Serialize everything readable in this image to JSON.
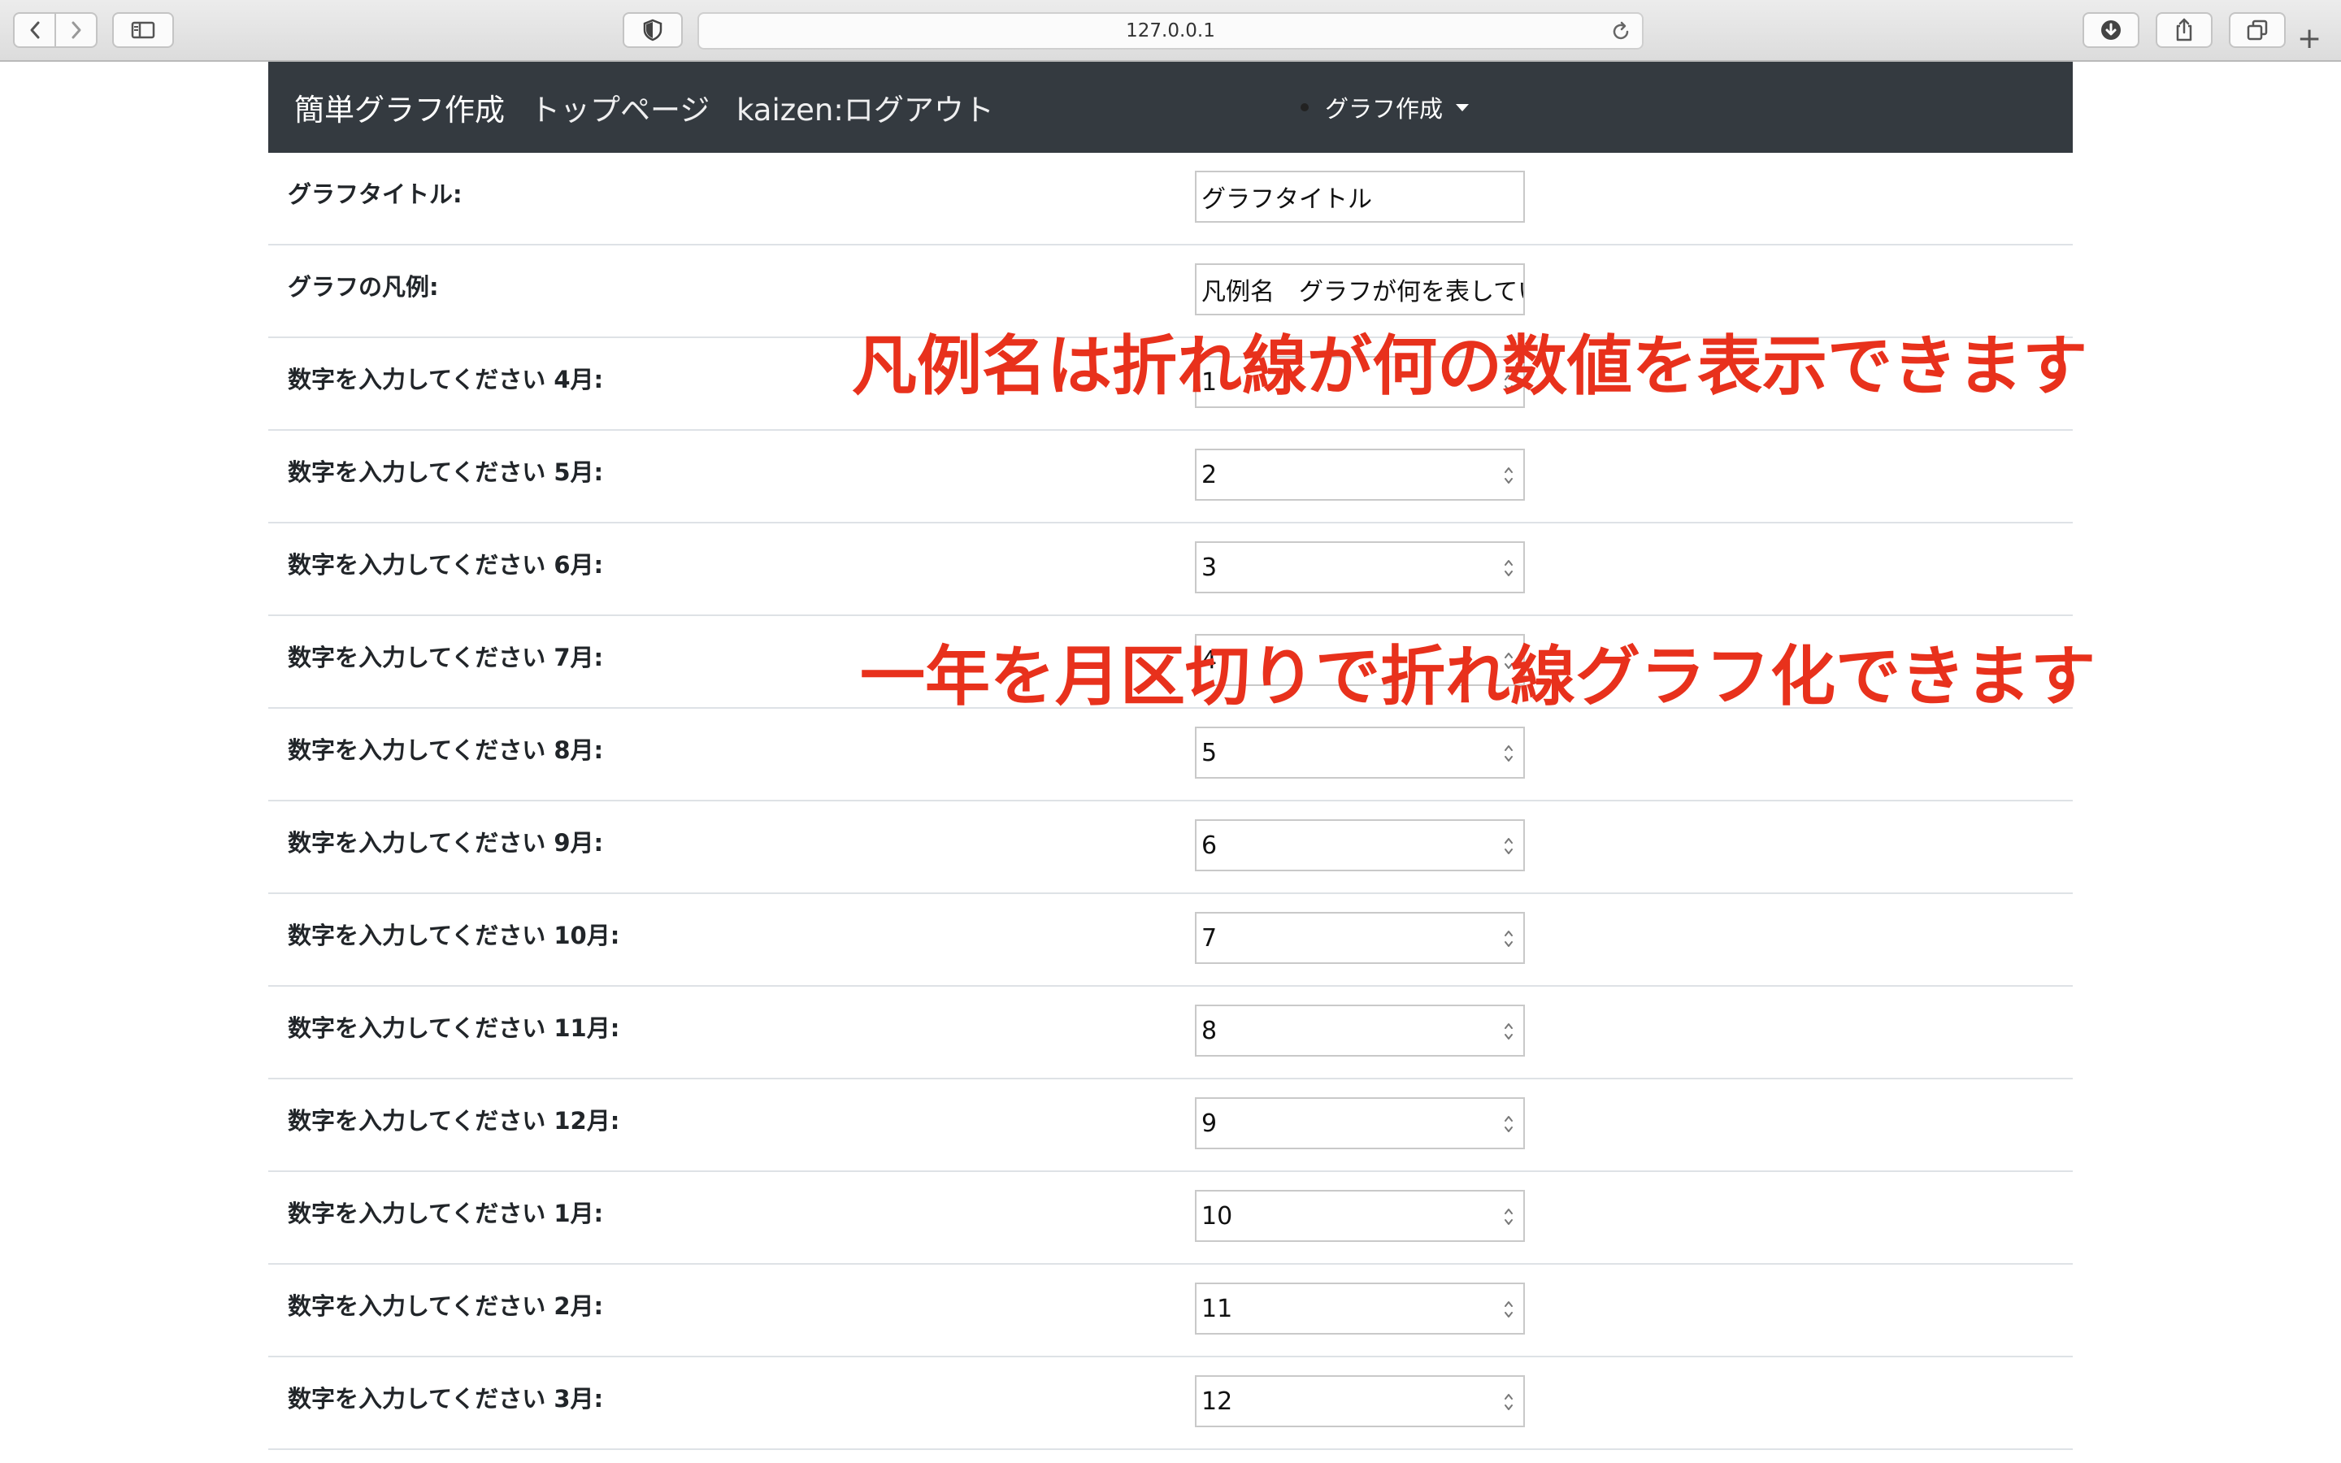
{
  "browser": {
    "url": "127.0.0.1",
    "icons": [
      "chevron-left-icon",
      "chevron-right-icon",
      "sidebar-icon",
      "shield-icon",
      "reload-icon",
      "download-icon",
      "share-icon",
      "tabs-icon",
      "plus-icon"
    ],
    "new_tab_label": "+"
  },
  "navbar": {
    "brand": "簡単グラフ作成",
    "top_page": "トップページ",
    "logout": "kaizen:ログアウト",
    "dropdown": "グラフ作成",
    "background": "#343a40"
  },
  "form": {
    "title_label": "グラフタイトル:",
    "title_value": "グラフタイトル",
    "legend_label": "グラフの凡例:",
    "legend_value": "凡例名　グラフが何を表してい",
    "months": [
      {
        "label": "数字を入力してください 4月:",
        "value": "1"
      },
      {
        "label": "数字を入力してください 5月:",
        "value": "2"
      },
      {
        "label": "数字を入力してください 6月:",
        "value": "3"
      },
      {
        "label": "数字を入力してください 7月:",
        "value": "4"
      },
      {
        "label": "数字を入力してください 8月:",
        "value": "5"
      },
      {
        "label": "数字を入力してください 9月:",
        "value": "6"
      },
      {
        "label": "数字を入力してください 10月:",
        "value": "7"
      },
      {
        "label": "数字を入力してください 11月:",
        "value": "8"
      },
      {
        "label": "数字を入力してください 12月:",
        "value": "9"
      },
      {
        "label": "数字を入力してください 1月:",
        "value": "10"
      },
      {
        "label": "数字を入力してください 2月:",
        "value": "11"
      },
      {
        "label": "数字を入力してください 3月:",
        "value": "12"
      }
    ]
  },
  "annotations": {
    "legend_note": "凡例名は折れ線が何の数値を表示できます",
    "month_note": "一年を月区切りで折れ線グラフ化できます",
    "color": "#e8311c"
  }
}
